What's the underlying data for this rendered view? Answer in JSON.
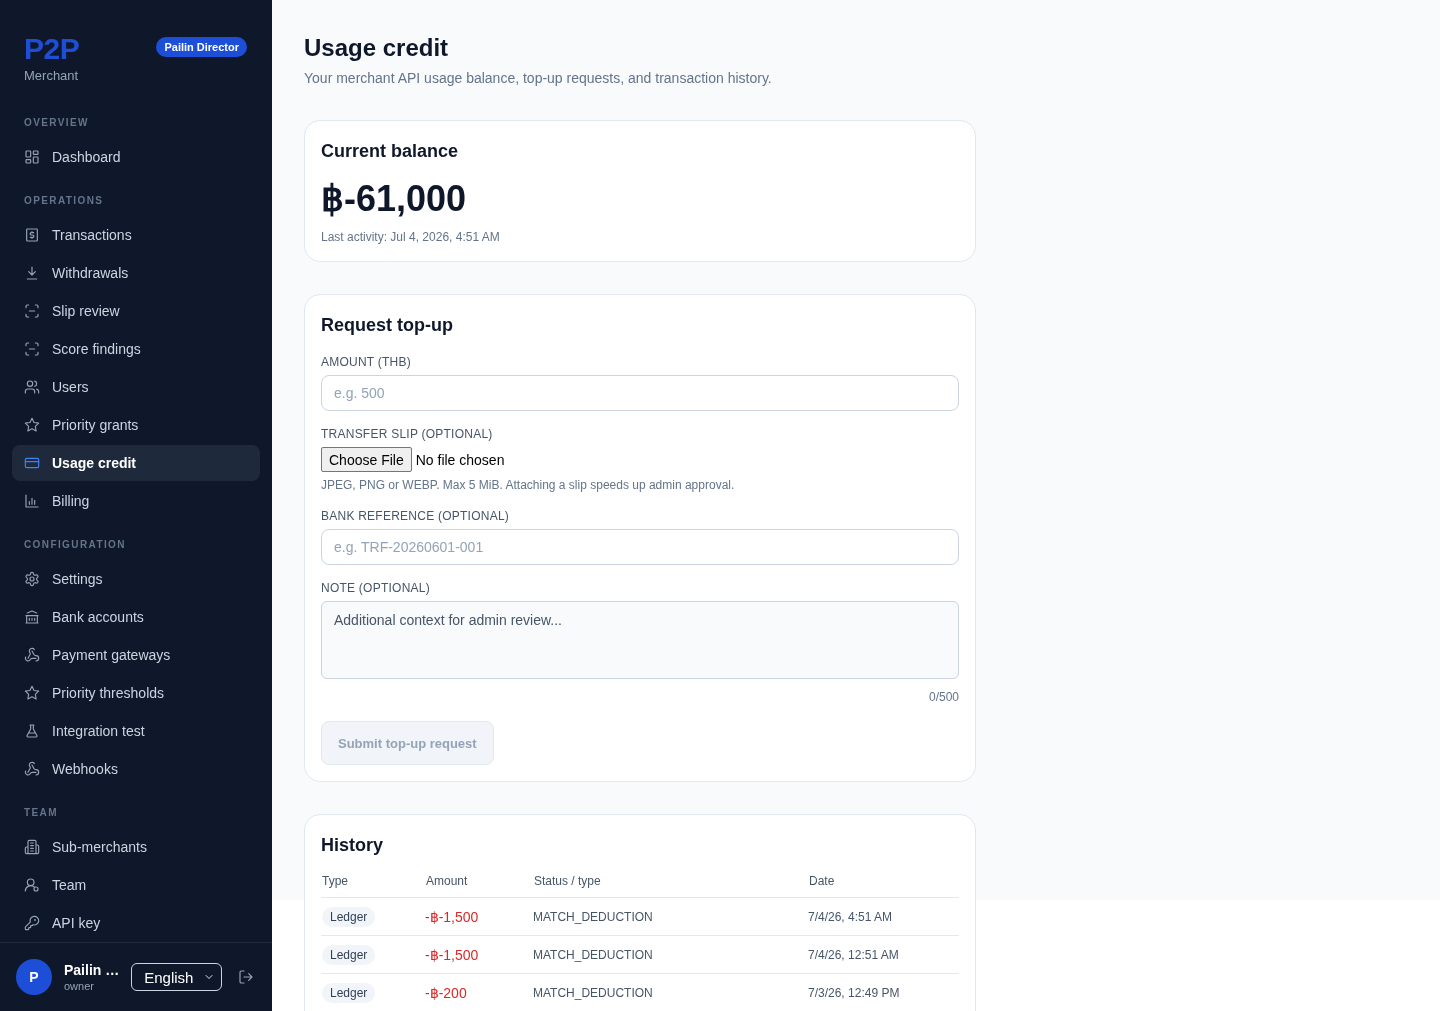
{
  "sidebar": {
    "logo": "P2P",
    "subtitle": "Merchant",
    "role_badge": "Pailin Director",
    "sections": [
      {
        "label": "OVERVIEW",
        "items": [
          {
            "label": "Dashboard",
            "selected": false
          }
        ]
      },
      {
        "label": "OPERATIONS",
        "items": [
          {
            "label": "Transactions",
            "selected": false
          },
          {
            "label": "Withdrawals",
            "selected": false
          },
          {
            "label": "Slip review",
            "selected": false
          },
          {
            "label": "Score findings",
            "selected": false
          },
          {
            "label": "Users",
            "selected": false
          },
          {
            "label": "Priority grants",
            "selected": false
          },
          {
            "label": "Usage credit",
            "selected": true
          },
          {
            "label": "Billing",
            "selected": false
          }
        ]
      },
      {
        "label": "CONFIGURATION",
        "items": [
          {
            "label": "Settings",
            "selected": false
          },
          {
            "label": "Bank accounts",
            "selected": false
          },
          {
            "label": "Payment gateways",
            "selected": false
          },
          {
            "label": "Priority thresholds",
            "selected": false
          },
          {
            "label": "Integration test",
            "selected": false
          },
          {
            "label": "Webhooks",
            "selected": false
          }
        ]
      },
      {
        "label": "TEAM",
        "items": [
          {
            "label": "Sub-merchants",
            "selected": false
          },
          {
            "label": "Team",
            "selected": false
          },
          {
            "label": "API key",
            "selected": false
          }
        ]
      }
    ],
    "user": {
      "avatar_initial": "P",
      "name": "Pailin …",
      "role": "owner"
    },
    "language": "English"
  },
  "page": {
    "title": "Usage credit",
    "subtitle": "Your merchant API usage balance, top-up requests, and transaction history."
  },
  "balance_card": {
    "title": "Current balance",
    "amount": "฿-61,000",
    "last_activity": "Last activity: Jul 4, 2026, 4:51 AM"
  },
  "topup_form": {
    "title": "Request top-up",
    "fields": [
      {
        "kind": "text",
        "label": "AMOUNT (THB)",
        "placeholder": "e.g. 500"
      },
      {
        "kind": "file",
        "label": "TRANSFER SLIP (OPTIONAL)",
        "button": "Choose File",
        "status": "No file chosen",
        "hint": "JPEG, PNG or WEBP. Max 5 MiB. Attaching a slip speeds up admin approval."
      },
      {
        "kind": "text",
        "label": "BANK REFERENCE (OPTIONAL)",
        "placeholder": "e.g. TRF-20260601-001"
      },
      {
        "kind": "textarea",
        "label": "NOTE (OPTIONAL)",
        "placeholder": "Additional context for admin review...",
        "counter": "0/500"
      }
    ],
    "submit": {
      "label": "Submit top-up request",
      "disabled": true
    }
  },
  "history": {
    "title": "History",
    "columns": [
      "Type",
      "Amount",
      "Status / type",
      "Date"
    ],
    "rows": [
      {
        "type": "Ledger",
        "amount": "-฿-1,500",
        "status": "MATCH_DEDUCTION",
        "date": "7/4/26, 4:51 AM"
      },
      {
        "type": "Ledger",
        "amount": "-฿-1,500",
        "status": "MATCH_DEDUCTION",
        "date": "7/4/26, 12:51 AM"
      },
      {
        "type": "Ledger",
        "amount": "-฿-200",
        "status": "MATCH_DEDUCTION",
        "date": "7/3/26, 12:49 PM"
      }
    ]
  }
}
